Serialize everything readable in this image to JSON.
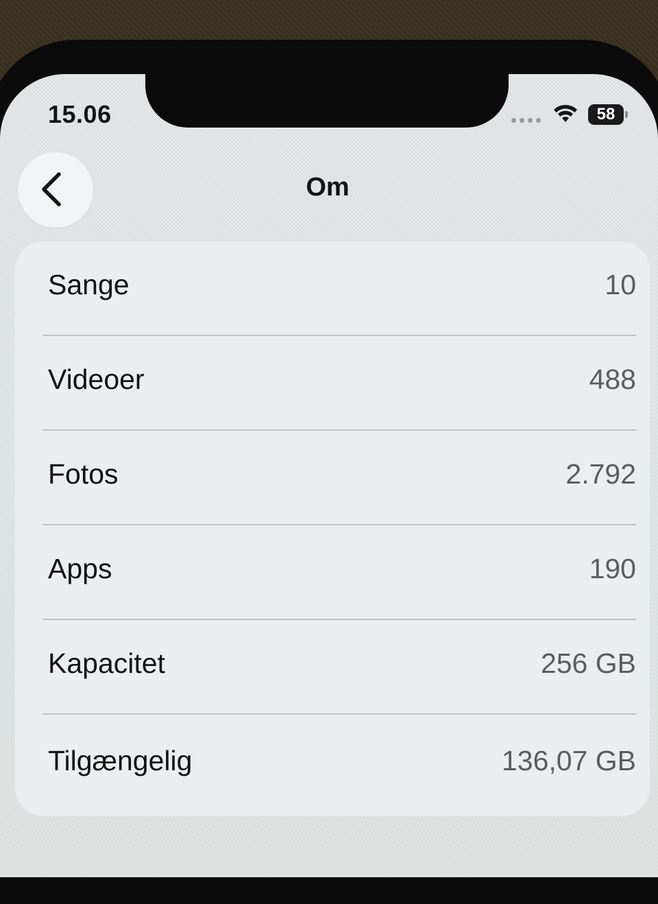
{
  "status_bar": {
    "time": "15.06",
    "battery_level": "58",
    "icons": [
      "signal-icon",
      "wifi-icon",
      "battery-icon"
    ]
  },
  "nav": {
    "title": "Om",
    "back_icon": "chevron-left-icon"
  },
  "rows": [
    {
      "label": "Sange",
      "value": "10"
    },
    {
      "label": "Videoer",
      "value": "488"
    },
    {
      "label": "Fotos",
      "value": "2.792"
    },
    {
      "label": "Apps",
      "value": "190"
    },
    {
      "label": "Kapacitet",
      "value": "256 GB"
    },
    {
      "label": "Tilgængelig",
      "value": "136,07 GB"
    }
  ],
  "colors": {
    "screen_bg": "#e2e6e6",
    "card_bg": "#eceff0",
    "label_text": "#121212",
    "value_text": "#5a5c5e",
    "divider": "#bfc3c3"
  }
}
